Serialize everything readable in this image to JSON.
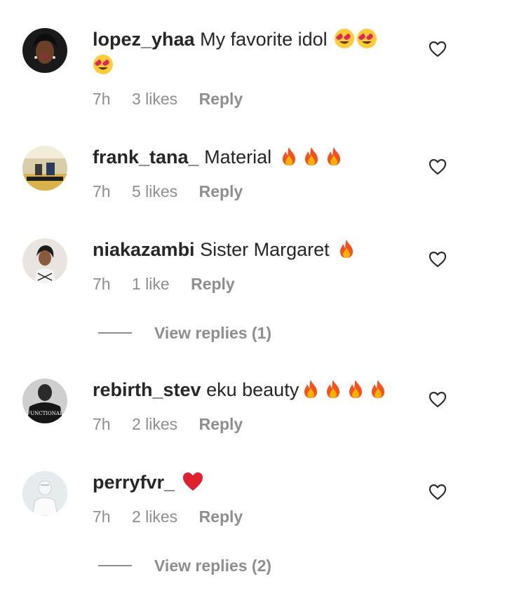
{
  "comments": [
    {
      "username": "lopez_yhaa",
      "text": "My favorite idol",
      "emoji": [
        "heart-eyes-emoji",
        "heart-eyes-emoji",
        "heart-eyes-emoji"
      ],
      "time": "7h",
      "likes": "3 likes",
      "reply_label": "Reply"
    },
    {
      "username": "frank_tana_",
      "text": "Material",
      "emoji": [
        "fire-emoji",
        "fire-emoji",
        "fire-emoji"
      ],
      "time": "7h",
      "likes": "5 likes",
      "reply_label": "Reply"
    },
    {
      "username": "niakazambi",
      "text": "Sister Margaret",
      "emoji": [
        "fire-emoji"
      ],
      "time": "7h",
      "likes": "1 like",
      "reply_label": "Reply",
      "view_replies": "View replies (1)"
    },
    {
      "username": "rebirth_stev",
      "text": "eku beauty",
      "emoji": [
        "fire-emoji",
        "fire-emoji",
        "fire-emoji",
        "fire-emoji"
      ],
      "time": "7h",
      "likes": "2 likes",
      "reply_label": "Reply"
    },
    {
      "username": "perryfvr_",
      "text": "",
      "emoji": [
        "red-heart-emoji"
      ],
      "time": "7h",
      "likes": "2 likes",
      "reply_label": "Reply",
      "view_replies": "View replies (2)"
    }
  ],
  "avatar_text": "FUNCTIONAL",
  "colors": {
    "text": "#262626",
    "secondary": "#8e8e8e",
    "background": "#ffffff"
  }
}
